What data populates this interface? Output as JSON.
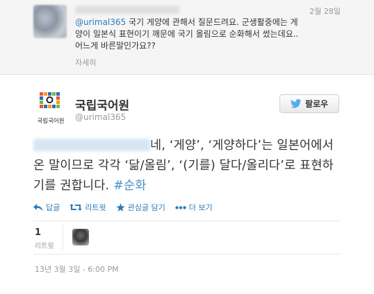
{
  "parent_tweet": {
    "date": "2월 28일",
    "mention": "@urimal365",
    "text_after_mention": " 국기 게양에 관해서 질문드려요. 군생활중에는 게양이 일본식 표현이기 깨문에 국기 올림으로 순화해서 썼는데요.. 어느게 바른말인가요??",
    "detail_link": "자세히"
  },
  "main_tweet": {
    "display_name": "국립국어원",
    "handle": "@urimal365",
    "logo_caption": "국립국어원",
    "follow_label": "팔로우",
    "text": "네, ‘게양’, ‘게양하다’는 일본어에서 온 말이므로 각각 ‘닮/올림’, ‘(기를) 달다/올리다’로 표현하기를 권합니다. ",
    "hashtag": "#순화",
    "actions": {
      "reply": "답글",
      "retweet": "리트윗",
      "favorite": "관심글 담기",
      "more": "더 보기"
    },
    "retweet_count": "1",
    "retweet_label": "리트윗",
    "timestamp": "13년 3월 3일 - 6:00 PM"
  },
  "colors": {
    "link": "#2b7bb9",
    "hashtag": "#4a90c8",
    "follow_bird": "#55acee"
  }
}
